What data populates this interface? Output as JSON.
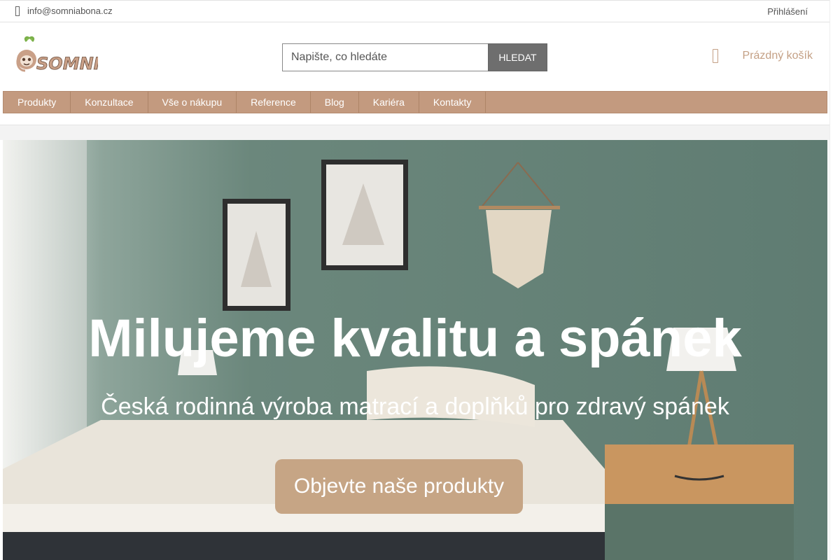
{
  "topbar": {
    "email": "info@somniabona.cz",
    "login_label": "Přihlášení"
  },
  "header": {
    "logo_text": "SOMNIA",
    "search": {
      "placeholder": "Napište, co hledáte",
      "button_label": "HLEDAT"
    },
    "cart_label": "Prázdný košík"
  },
  "nav": {
    "items": [
      "Produkty",
      "Konzultace",
      "Vše o nákupu",
      "Reference",
      "Blog",
      "Kariéra",
      "Kontakty"
    ]
  },
  "hero": {
    "title": "Milujeme kvalitu a spánek",
    "subtitle": "Česká rodinná výroba matrací a doplňků pro zdravý spánek",
    "cta_label": "Objevte naše produkty"
  },
  "colors": {
    "brand": "#c39a7f",
    "cart": "#c4a085",
    "wall": "#6c8a7e",
    "cta": "#c6a585"
  },
  "icons": {
    "email": "envelope-icon",
    "cart": "cart-icon"
  }
}
